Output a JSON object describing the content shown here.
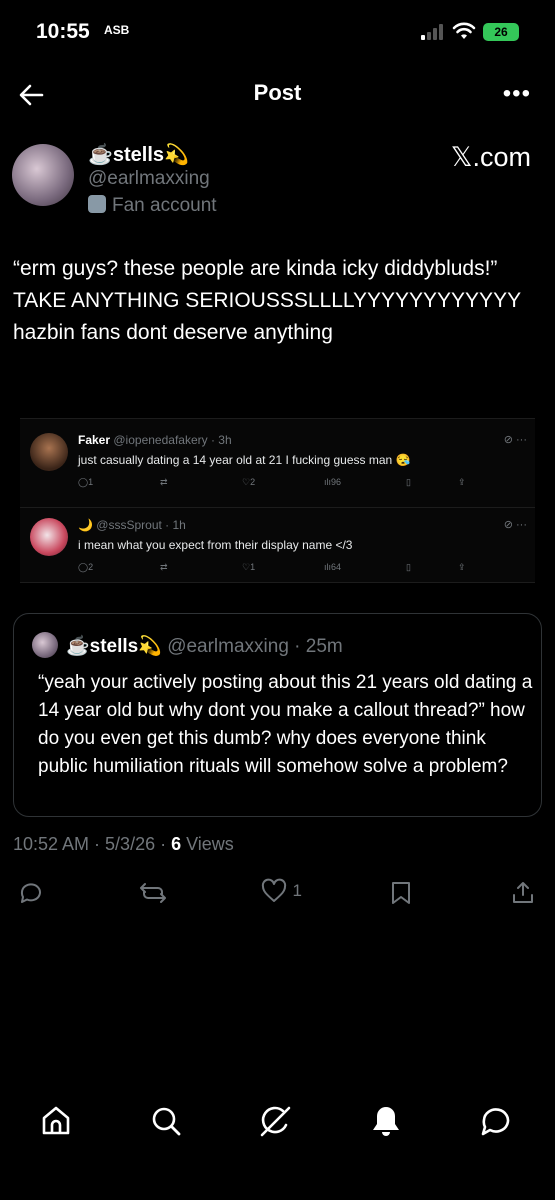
{
  "status_bar": {
    "time": "10:55",
    "silent_indicator": "ASB",
    "battery": "26"
  },
  "nav": {
    "title": "Post",
    "back_icon": "arrow-left-icon",
    "more_icon": "more-horizontal-icon"
  },
  "author": {
    "name": "☕stells💫",
    "handle": "@earlmaxxing",
    "label": "Fan account",
    "brand": "𝕏.com"
  },
  "post": {
    "text": "“erm guys? these people are kinda icky diddybluds!” TAKE ANYTHING SERIOUSSSLLLLYYYYYYYYYYYY hazbin fans dont deserve anything"
  },
  "embedded_replies": [
    {
      "name": "Faker",
      "meta": "@iopenedafakery · 3h",
      "text": "just casually dating a 14 year old at 21 I fucking guess man 😪",
      "replies": "1",
      "likes": "2",
      "views": "96"
    },
    {
      "name": "🌙",
      "meta": "@sssSprout · 1h",
      "text": "i mean what you expect from their display name </3",
      "replies": "2",
      "likes": "1",
      "views": "64"
    }
  ],
  "quote": {
    "name": "☕stells💫",
    "meta": "@earlmaxxing · 25m",
    "text": "“yeah your actively posting about this 21 years old dating a 14 year old but why dont you make a callout thread?” how do you even get this dumb? why does everyone think public humiliation rituals will somehow solve a problem?"
  },
  "footer": {
    "time_date": "10:52 AM · 5/3/26 · ",
    "views_count": "6",
    "views_label": " Views",
    "likes": "1"
  },
  "colors": {
    "background": "#000000",
    "text": "#e7e9ea",
    "muted": "#71767b",
    "border": "#2f3336",
    "battery": "#34c759"
  }
}
